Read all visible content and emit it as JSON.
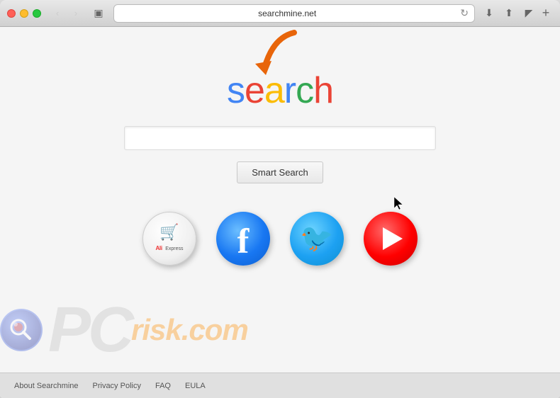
{
  "browser": {
    "address": "searchmine.net",
    "title": "searchmine.net"
  },
  "page": {
    "logo_letters": [
      "s",
      "e",
      "a",
      "r",
      "c",
      "h"
    ],
    "logo_text": "search",
    "search_placeholder": "",
    "smart_search_label": "Smart Search"
  },
  "social_icons": [
    {
      "id": "aliexpress",
      "label": "AliExpress"
    },
    {
      "id": "facebook",
      "label": "Facebook"
    },
    {
      "id": "twitter",
      "label": "Twitter"
    },
    {
      "id": "youtube",
      "label": "YouTube"
    }
  ],
  "footer": {
    "links": [
      {
        "label": "About Searchmine"
      },
      {
        "label": "Privacy Policy"
      },
      {
        "label": "FAQ"
      },
      {
        "label": "EULA"
      }
    ]
  },
  "watermark": {
    "pc_text": "PC",
    "risk_text": "risk",
    "dot_com": ".com"
  }
}
